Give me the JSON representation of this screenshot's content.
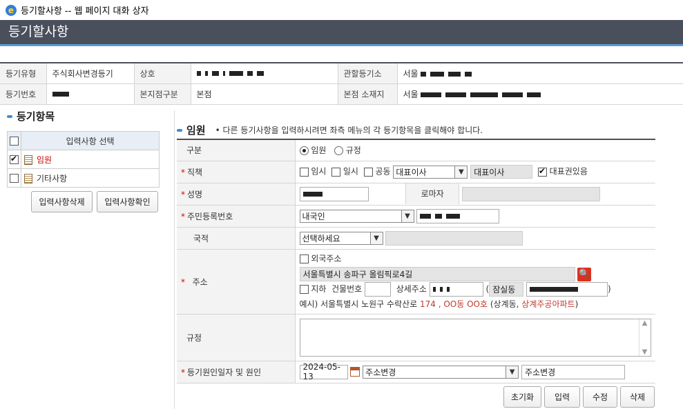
{
  "window": {
    "title": "등기할사항 -- 웹 페이지 대화 상자"
  },
  "header": {
    "title": "등기할사항"
  },
  "info": {
    "type_label": "등기유형",
    "type_value": "주식회사변경등기",
    "name_label": "상호",
    "court_label": "관할등기소",
    "court_value": "서울",
    "reg_no_label": "등기번호",
    "branch_label": "본지점구분",
    "branch_value": "본점",
    "location_label": "본점 소재지",
    "location_value": "서울"
  },
  "left": {
    "title": "등기항목",
    "header": "입력사항 선택",
    "items": [
      {
        "label": "임원",
        "checked": true
      },
      {
        "label": "기타사항",
        "checked": false
      }
    ],
    "delete_btn": "입력사항삭제",
    "confirm_btn": "입력사항확인"
  },
  "main": {
    "title": "임원",
    "note": "다른 등기사항을 입력하시려면 좌측 메뉴의 각 등기항목을 클릭해야 합니다.",
    "rows": {
      "division_label": "구분",
      "division_opt1": "임원",
      "division_opt2": "규정",
      "position_label": "직책",
      "temp_label": "임시",
      "vacancy_label": "일시",
      "joint_label": "공동",
      "position_select": "대표이사",
      "position_value": "대표이사",
      "rep_right_label": "대표권있음",
      "name_label": "성명",
      "roman_label": "로마자",
      "rrn_label": "주민등록번호",
      "rrn_select": "내국인",
      "nationality_label": "국적",
      "nationality_select": "선택하세요",
      "address_label": "주소",
      "foreign_addr_label": "외국주소",
      "address_value": "서울특별시 송파구 올림픽로4길",
      "basement_label": "지하",
      "building_no_label": "건물번호",
      "detail_addr_label": "상세주소",
      "dong_value": "잠실동",
      "example_prefix": "예시) 서울특별시 노원구 수락산로 ",
      "example_red1": "174 , OO동 OO호",
      "example_mid": " (상계동, ",
      "example_red2": "상계주공아파트",
      "example_end": ")",
      "rule_label": "규정",
      "cause_label": "등기원인일자 및 원인",
      "cause_date": "2024-05-13",
      "cause_select": "주소변경",
      "cause_value": "주소변경"
    }
  },
  "buttons": {
    "reset": "초기화",
    "input": "입력",
    "edit": "수정",
    "delete": "삭제"
  }
}
